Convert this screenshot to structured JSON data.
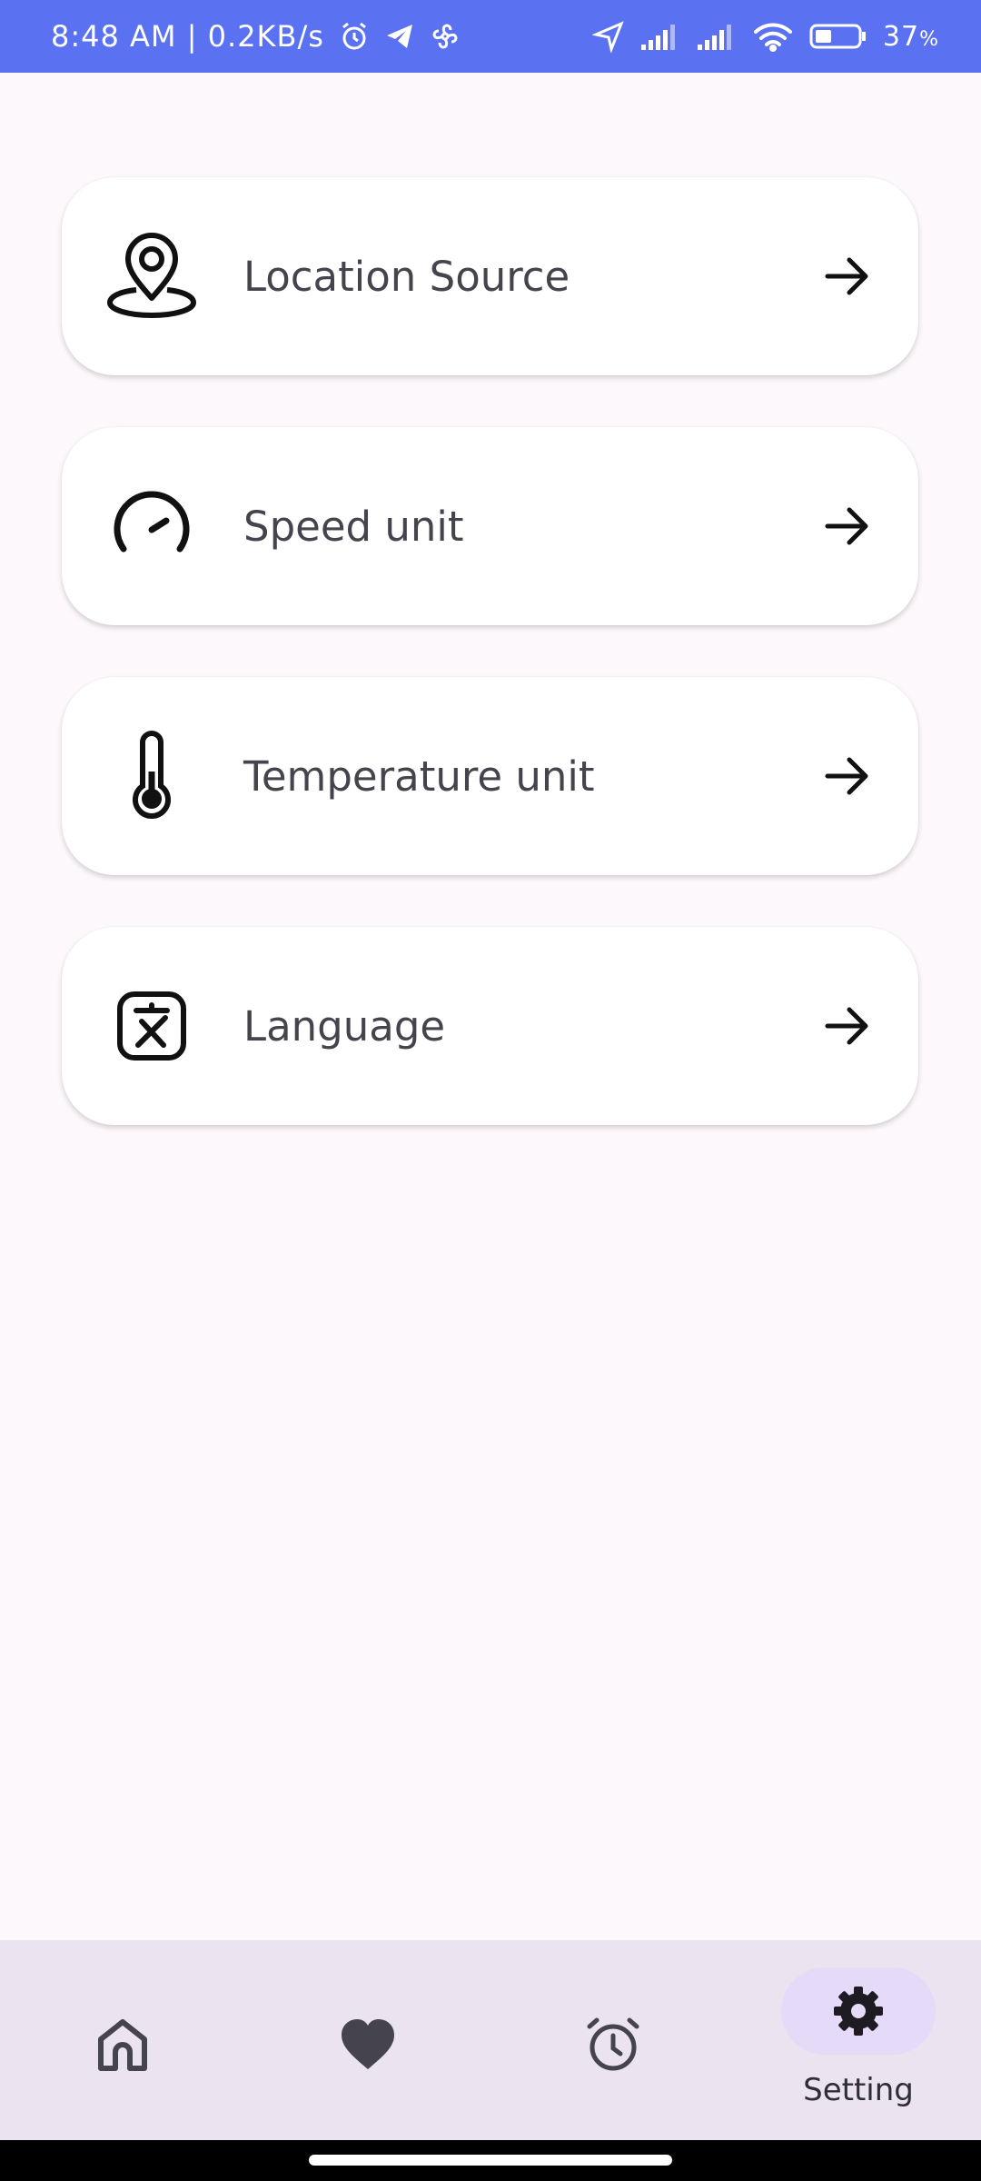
{
  "status_bar": {
    "time_info": "8:48 AM | 0.2KB/s",
    "battery": "37",
    "battery_unit": "%",
    "background": "#5a71f2",
    "icons": [
      "alarm-icon",
      "telegram-icon",
      "pinwheel-icon",
      "location-arrow-icon",
      "signal-icon",
      "signal-icon",
      "wifi-icon",
      "battery-icon"
    ]
  },
  "settings": {
    "items": [
      {
        "label": "Location Source",
        "icon": "location-pin-icon"
      },
      {
        "label": "Speed unit",
        "icon": "speedometer-icon"
      },
      {
        "label": "Temperature unit",
        "icon": "thermometer-icon"
      },
      {
        "label": "Language",
        "icon": "translate-icon"
      }
    ],
    "arrow_icon": "arrow-right-icon"
  },
  "bottom_nav": {
    "items": [
      {
        "icon": "home-icon",
        "label": ""
      },
      {
        "icon": "heart-icon",
        "label": ""
      },
      {
        "icon": "alarm-clock-icon",
        "label": ""
      },
      {
        "icon": "gear-icon",
        "label": "Setting",
        "active": true
      }
    ],
    "background": "#ebe3f0",
    "active_pill": "#e5daf8"
  }
}
